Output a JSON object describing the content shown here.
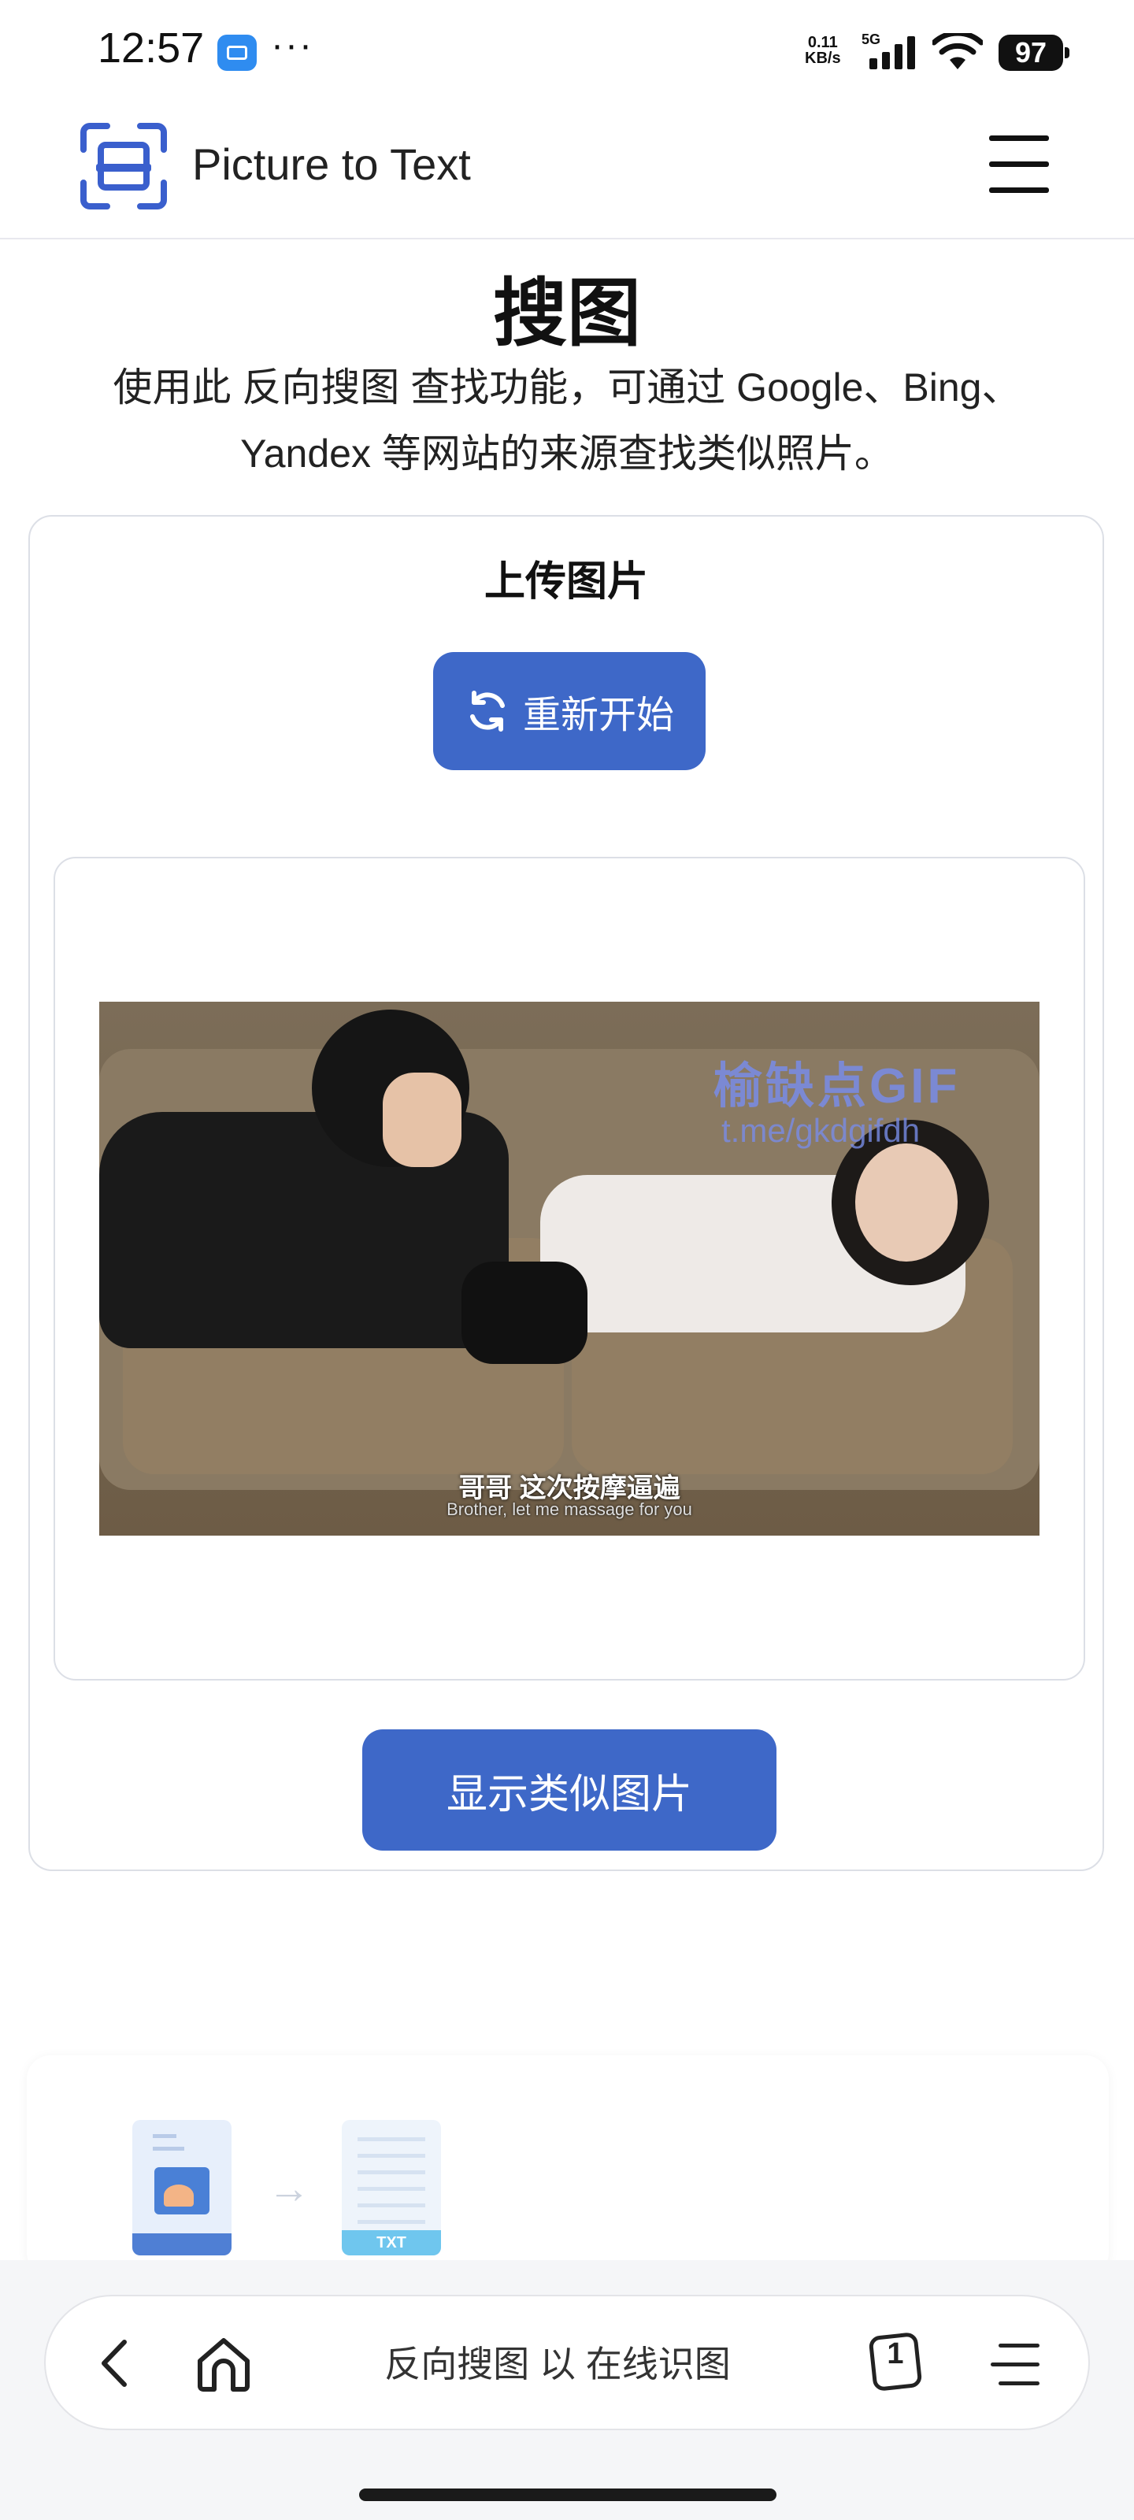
{
  "status_bar": {
    "time": "12:57",
    "more": "···",
    "net_speed_value": "0.11",
    "net_speed_unit": "KB/s",
    "network": "5G",
    "battery": "97"
  },
  "header": {
    "brand": "Picture to Text",
    "logo_icon": "scan-icon",
    "menu_icon": "hamburger-icon"
  },
  "page": {
    "title": "搜图",
    "description": "使用此 反向搜图 查找功能，可通过 Google、Bing、Yandex 等网站的来源查找类似照片。"
  },
  "upload": {
    "title": "上传图片",
    "restart_label": "重新开始",
    "similar_label": "显示类似图片",
    "image": {
      "watermark_line1": "榆缺点GIF",
      "watermark_line2": "t.me/gkdgifdh",
      "subtitle_cn": "哥哥 这次按摩逼遍",
      "subtitle_en": "Brother, let me massage for you"
    }
  },
  "feature": {
    "txt_tag": "TXT"
  },
  "browser": {
    "address": "反向搜图 以 在线识图",
    "tab_count": "1"
  },
  "colors": {
    "accent": "#3e68c8",
    "logo_blue": "#3a5fcd"
  }
}
